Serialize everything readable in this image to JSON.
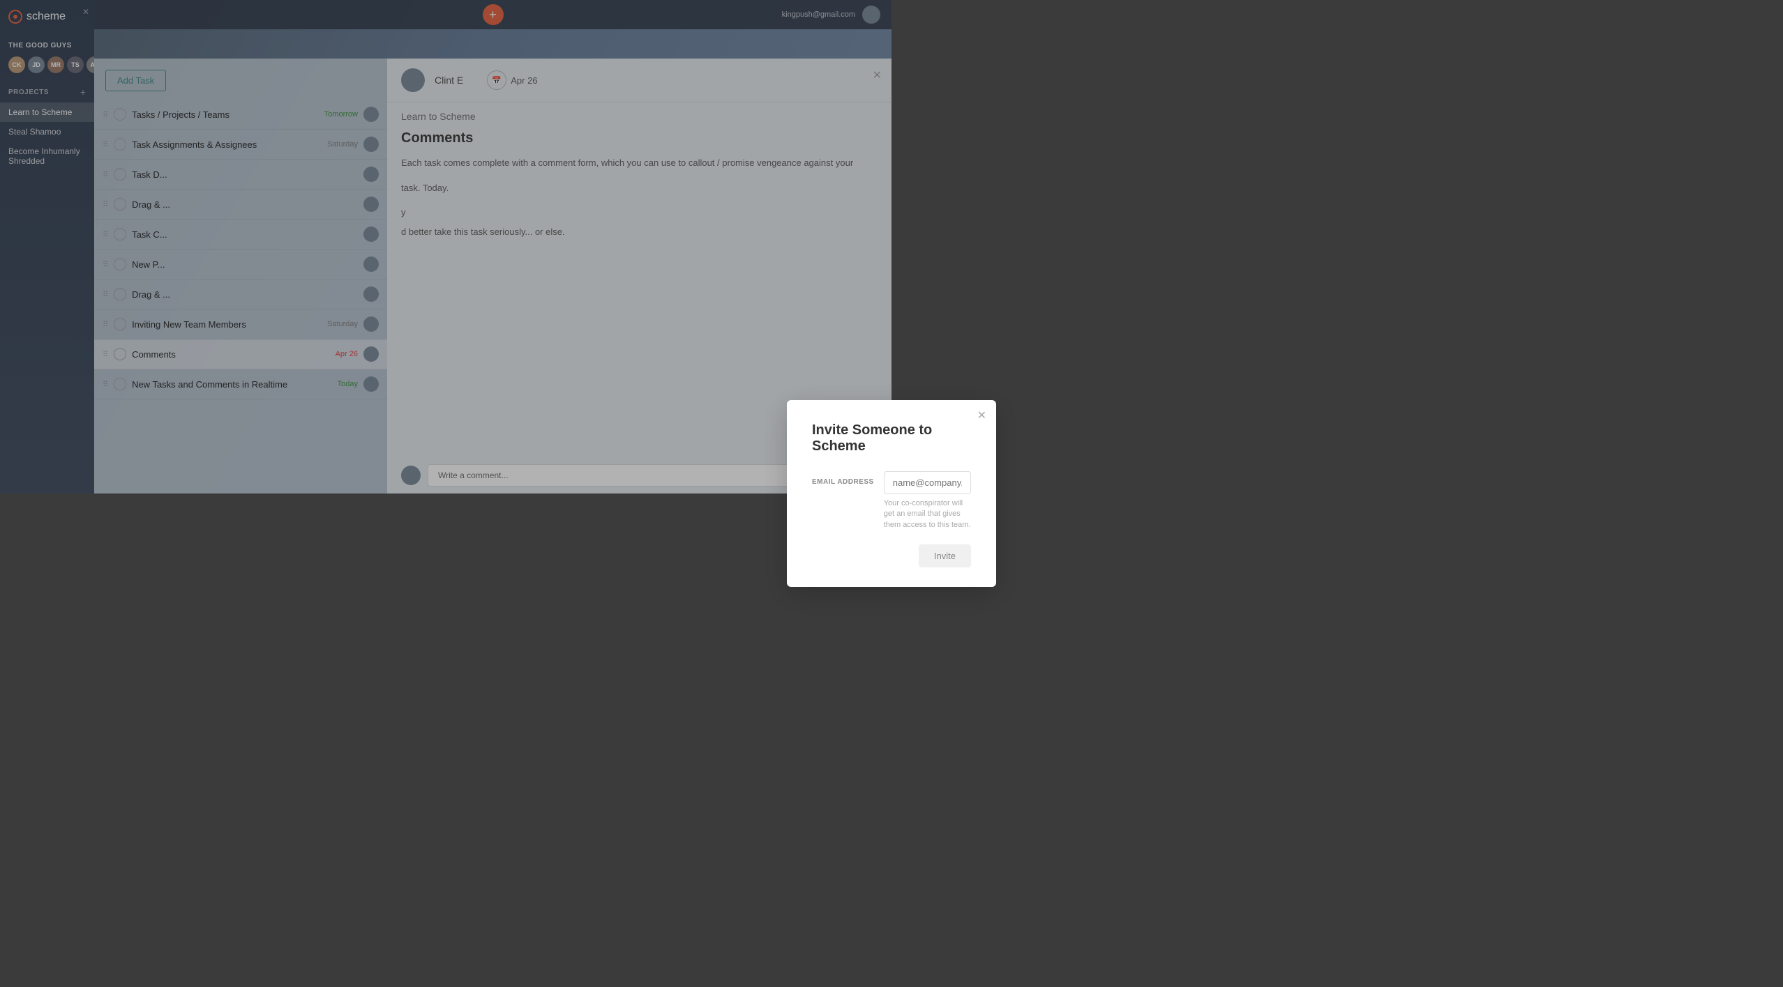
{
  "sidebar": {
    "logo": "scheme",
    "close_label": "✕",
    "team_name": "THE GOOD GUYS",
    "projects_label": "PROJECTS",
    "projects_add": "+",
    "projects": [
      {
        "id": "learn-to-scheme",
        "label": "Learn to Scheme",
        "active": true
      },
      {
        "id": "steal-shamoo",
        "label": "Steal Shamoo",
        "active": false
      },
      {
        "id": "become-inhumanly-shredded",
        "label": "Become Inhumanly Shredded",
        "active": false
      }
    ]
  },
  "topbar": {
    "add_icon": "+",
    "user_email": "kingpush@gmail.com"
  },
  "task_list": {
    "add_task_label": "Add Task",
    "tasks": [
      {
        "id": 1,
        "name": "Tasks / Projects / Teams",
        "due": "Tomorrow",
        "due_class": "tomorrow",
        "highlighted": false
      },
      {
        "id": 2,
        "name": "Task Assignments & Assignees",
        "due": "Saturday",
        "due_class": "",
        "highlighted": false
      },
      {
        "id": 3,
        "name": "Task D...",
        "due": "",
        "due_class": "",
        "highlighted": false
      },
      {
        "id": 4,
        "name": "Drag & ...",
        "due": "",
        "due_class": "",
        "highlighted": false
      },
      {
        "id": 5,
        "name": "Task C...",
        "due": "",
        "due_class": "",
        "highlighted": false
      },
      {
        "id": 6,
        "name": "New P...",
        "due": "",
        "due_class": "",
        "highlighted": false
      },
      {
        "id": 7,
        "name": "Drag & ...",
        "due": "",
        "due_class": "",
        "highlighted": false
      },
      {
        "id": 8,
        "name": "Inviting New Team Members",
        "due": "Saturday",
        "due_class": "",
        "highlighted": false
      },
      {
        "id": 9,
        "name": "Comments",
        "due": "Apr 26",
        "due_class": "overdue",
        "highlighted": true
      },
      {
        "id": 10,
        "name": "New Tasks and Comments in Realtime",
        "due": "Today",
        "due_class": "today",
        "highlighted": false
      }
    ]
  },
  "task_detail": {
    "assignee_name": "Clint E",
    "date": "Apr 26",
    "task_path": "Learn to Scheme",
    "section_title": "Comments",
    "body_text": "Each task comes complete with a comment form, which you can use to callout / promise vengeance against your",
    "body_text2": "task. Today.",
    "body_text3": "y",
    "body_text4": "d better take this task seriously... or else.",
    "close_label": "✕",
    "comment_placeholder": "Write a comment..."
  },
  "modal": {
    "title": "Invite Someone to Scheme",
    "close_label": "✕",
    "email_label": "EMAIL ADDRESS",
    "email_placeholder": "name@company.com",
    "hint_text": "Your co-conspirator will get an email that gives them access to this team.",
    "invite_label": "Invite"
  }
}
